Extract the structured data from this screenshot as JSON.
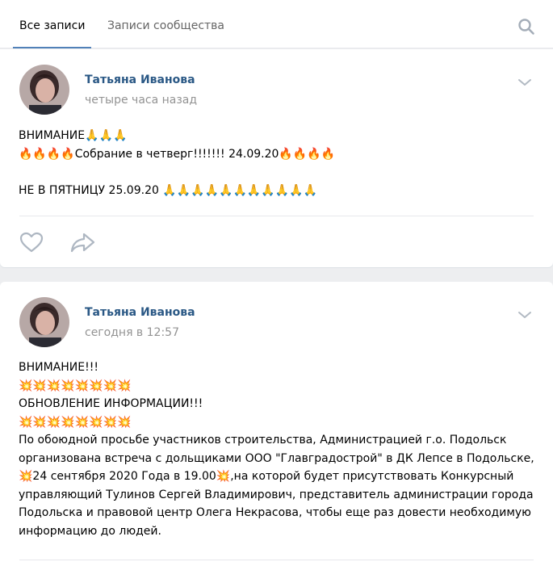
{
  "tabs": {
    "all_posts": "Все записи",
    "community_posts": "Записи сообщества"
  },
  "colors": {
    "accent": "#5181b8",
    "author_link": "#2a5885",
    "muted_text": "#939393",
    "page_bg": "#edeef0"
  },
  "icons": {
    "search": "search-icon",
    "chevron": "chevron-down-icon",
    "like": "heart-icon",
    "share": "share-arrow-icon",
    "pray": "🙏",
    "fire": "🔥",
    "boom": "💥"
  },
  "posts": [
    {
      "author": "Татьяна Иванова",
      "time": "четыре часа назад",
      "text": "ВНИМАНИЕ🙏🙏🙏\n🔥🔥🔥🔥Собрание в четверг!!!!!!! 24.09.20🔥🔥🔥🔥\n\nНЕ В ПЯТНИЦУ 25.09.20 🙏🙏🙏🙏🙏🙏🙏🙏🙏🙏🙏"
    },
    {
      "author": "Татьяна Иванова",
      "time": "сегодня в 12:57",
      "text": "ВНИМАНИЕ!!!\n💥💥💥💥💥💥💥💥\nОБНОВЛЕНИЕ ИНФОРМАЦИИ!!!\n💥💥💥💥💥💥💥💥\nПо обоюдной просьбе участников строительства, Администрацией г.о. Подольск организована встреча с дольщиками ООО \"Главградострой\" в ДК Лепсе в Подольске, 💥24 сентября 2020 Года в 19.00💥,на которой будет присутствовать Конкурсный управляющий Тулинов Сергей Владимирович, представитель администрации города Подольска и правовой центр Олега Некрасова, чтобы еще раз довести необходимую информацию до людей."
    }
  ]
}
